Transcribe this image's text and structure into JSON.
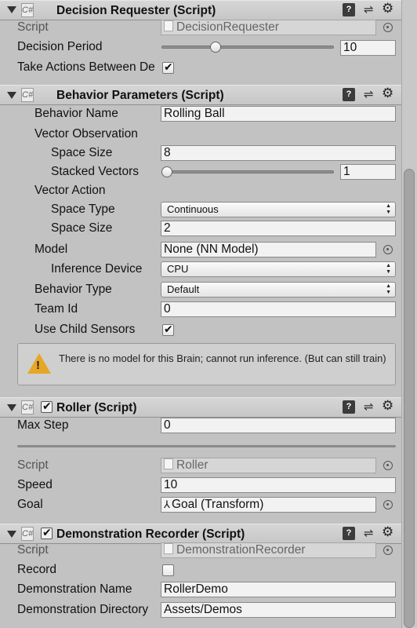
{
  "decision_requester": {
    "title": "Decision Requester (Script)",
    "script_label": "Script",
    "script_value": "DecisionRequester",
    "decision_period_label": "Decision Period",
    "decision_period_value": "10",
    "decision_period_slider": 0.3,
    "take_actions_label": "Take Actions Between De",
    "take_actions_checked": true
  },
  "behavior_parameters": {
    "title": "Behavior Parameters (Script)",
    "behavior_name_label": "Behavior Name",
    "behavior_name_value": "Rolling Ball",
    "vector_observation_label": "Vector Observation",
    "space_size_label": "Space Size",
    "space_size_value": "8",
    "stacked_vectors_label": "Stacked Vectors",
    "stacked_vectors_value": "1",
    "stacked_vectors_slider": 0.0,
    "vector_action_label": "Vector Action",
    "space_type_label": "Space Type",
    "space_type_value": "Continuous",
    "action_space_size_label": "Space Size",
    "action_space_size_value": "2",
    "model_label": "Model",
    "model_value": "None (NN Model)",
    "inference_device_label": "Inference Device",
    "inference_device_value": "CPU",
    "behavior_type_label": "Behavior Type",
    "behavior_type_value": "Default",
    "team_id_label": "Team Id",
    "team_id_value": "0",
    "use_child_sensors_label": "Use Child Sensors",
    "use_child_sensors_checked": true,
    "help_message": "There is no model for this Brain; cannot run inference. (But can still train)"
  },
  "roller": {
    "title": "Roller (Script)",
    "enabled": true,
    "max_step_label": "Max Step",
    "max_step_value": "0",
    "script_label": "Script",
    "script_value": "Roller",
    "speed_label": "Speed",
    "speed_value": "10",
    "goal_label": "Goal",
    "goal_value": "Goal (Transform)"
  },
  "demonstration_recorder": {
    "title": "Demonstration Recorder (Script)",
    "enabled": true,
    "script_label": "Script",
    "script_value": "DemonstrationRecorder",
    "record_label": "Record",
    "record_checked": false,
    "demo_name_label": "Demonstration Name",
    "demo_name_value": "RollerDemo",
    "demo_dir_label": "Demonstration Directory",
    "demo_dir_value": "Assets/Demos"
  },
  "icons": {
    "cs_script": "C#",
    "help": "?"
  }
}
